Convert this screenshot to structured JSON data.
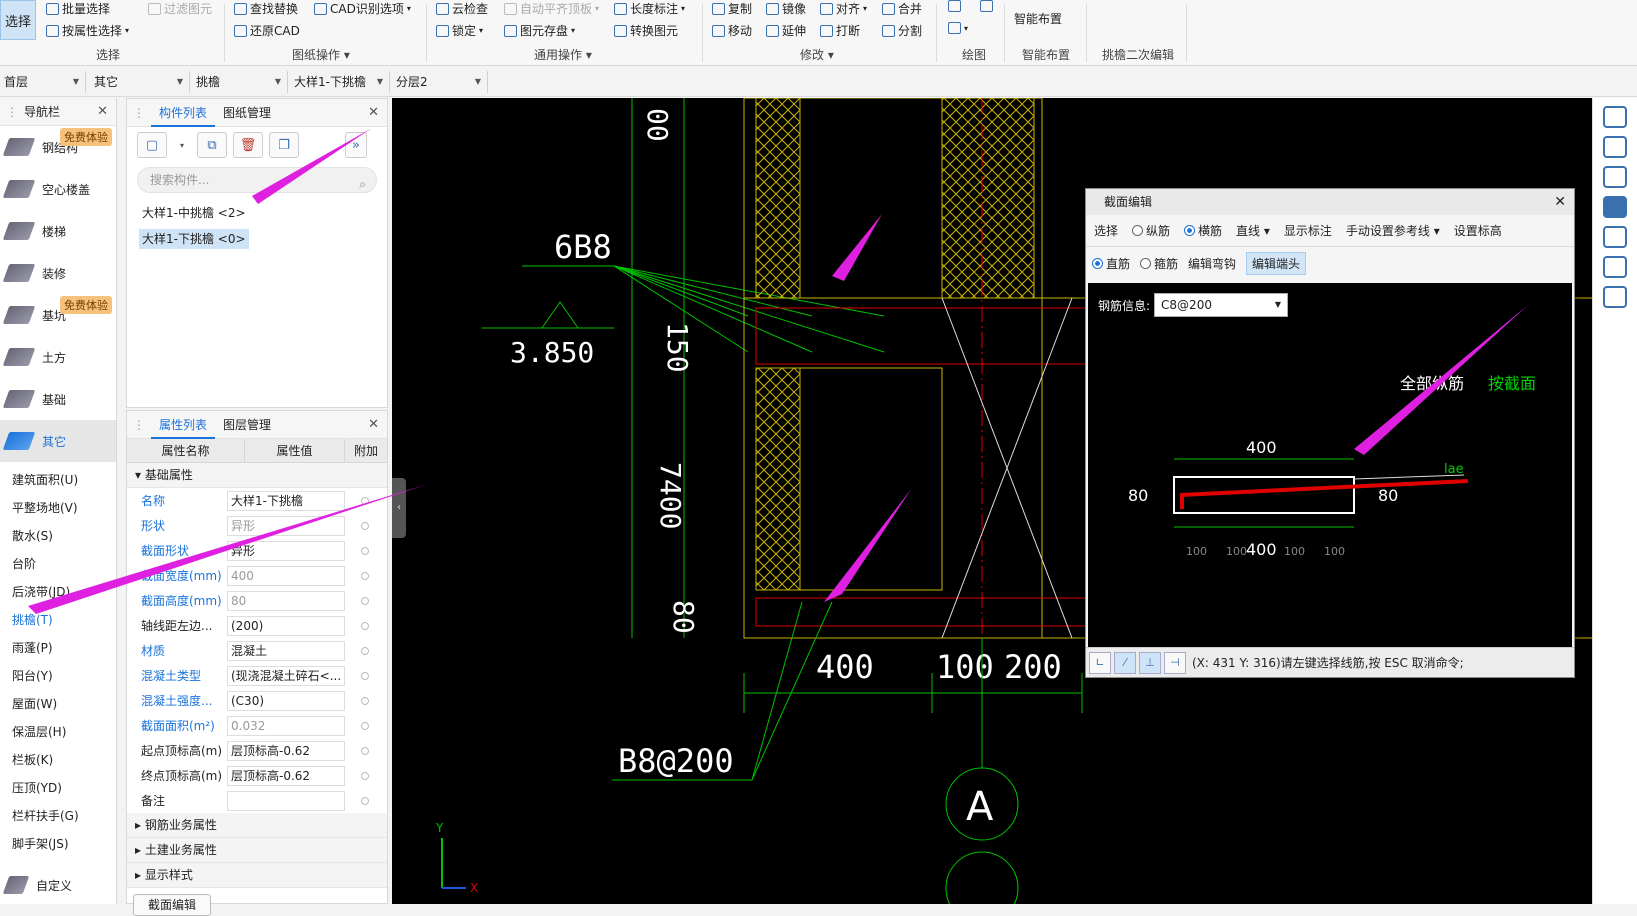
{
  "ribbon": {
    "select_label": "选择",
    "groups": {
      "select": {
        "label": "选择",
        "batch_select": "批量选择",
        "filter_graphic": "过滤图元",
        "select_by_attr": "按属性选择"
      },
      "drawing_ops": {
        "label": "图纸操作",
        "find_replace": "查找替换",
        "cad_recognize": "CAD识别选项",
        "restore_cad": "还原CAD"
      },
      "general_ops": {
        "label": "通用操作",
        "cloud_check": "云检查",
        "auto_level_slab": "自动平齐顶板",
        "lock": "锁定",
        "element_save": "图元存盘",
        "length_dim": "长度标注",
        "convert_element": "转换图元"
      },
      "modify": {
        "label": "修改",
        "copy": "复制",
        "mirror": "镜像",
        "align": "对齐",
        "merge": "合并",
        "move": "移动",
        "extend": "延伸",
        "break": "打断",
        "split": "分割"
      },
      "draw": {
        "label": "绘图"
      },
      "smart_layout": {
        "label": "智能布置",
        "button": "智能布置"
      },
      "eave_edit": {
        "label": "挑檐二次编辑"
      }
    }
  },
  "filterbar": {
    "floor": "首层",
    "category": "其它",
    "type": "挑檐",
    "component": "大样1-下挑檐",
    "layer": "分层2"
  },
  "nav": {
    "title": "导航栏",
    "items": [
      {
        "label": "钢结构",
        "badge": "免费体验"
      },
      {
        "label": "空心楼盖",
        "badge": ""
      },
      {
        "label": "楼梯",
        "badge": ""
      },
      {
        "label": "装修",
        "badge": ""
      },
      {
        "label": "基坑",
        "badge": "免费体验"
      },
      {
        "label": "土方",
        "badge": ""
      },
      {
        "label": "基础",
        "badge": ""
      },
      {
        "label": "其它",
        "badge": ""
      }
    ],
    "sub_items": [
      "建筑面积(U)",
      "平整场地(V)",
      "散水(S)",
      "台阶",
      "后浇带(JD)",
      "挑檐(T)",
      "雨蓬(P)",
      "阳台(Y)",
      "屋面(W)",
      "保温层(H)",
      "栏板(K)",
      "压顶(YD)",
      "栏杆扶手(G)",
      "脚手架(JS)"
    ],
    "custom": "自定义"
  },
  "components": {
    "tab_list": "构件列表",
    "tab_drawings": "图纸管理",
    "search_placeholder": "搜索构件...",
    "items": [
      "大样1-中挑檐 <2>",
      "大样1-下挑檐 <0>"
    ]
  },
  "properties": {
    "tab_attr": "属性列表",
    "tab_layer": "图层管理",
    "col_name": "属性名称",
    "col_value": "属性值",
    "col_extra": "附加",
    "group_basic": "基础属性",
    "rows": [
      {
        "name": "名称",
        "value": "大样1-下挑檐",
        "blue": true,
        "gray": false
      },
      {
        "name": "形状",
        "value": "异形",
        "blue": true,
        "gray": true
      },
      {
        "name": "截面形状",
        "value": "异形",
        "blue": true,
        "gray": false
      },
      {
        "name": "截面宽度(mm)",
        "value": "400",
        "blue": true,
        "gray": true
      },
      {
        "name": "截面高度(mm)",
        "value": "80",
        "blue": true,
        "gray": true
      },
      {
        "name": "轴线距左边...",
        "value": "(200)",
        "blue": false,
        "gray": false
      },
      {
        "name": "材质",
        "value": "混凝土",
        "blue": true,
        "gray": false
      },
      {
        "name": "混凝土类型",
        "value": "(现浇混凝土碎石<...",
        "blue": true,
        "gray": false
      },
      {
        "name": "混凝土强度...",
        "value": "(C30)",
        "blue": true,
        "gray": false
      },
      {
        "name": "截面面积(m²)",
        "value": "0.032",
        "blue": true,
        "gray": true
      },
      {
        "name": "起点顶标高(m)",
        "value": "层顶标高-0.62",
        "blue": false,
        "gray": false
      },
      {
        "name": "终点顶标高(m)",
        "value": "层顶标高-0.62",
        "blue": false,
        "gray": false
      },
      {
        "name": "备注",
        "value": "",
        "blue": false,
        "gray": false
      }
    ],
    "groups_collapsed": [
      "钢筋业务属性",
      "土建业务属性",
      "显示样式"
    ],
    "section_edit_btn": "截面编辑"
  },
  "cad": {
    "label_6b8": "6B8",
    "elev": "3.850",
    "dim_150": "150",
    "dim_700": "7400",
    "dim_80": "80",
    "dim_400": "400",
    "dim_100": "100",
    "dim_200": "200",
    "label_b8": "B8@200",
    "axis_a": "A"
  },
  "section_dialog": {
    "title": "截面编辑",
    "toolbar": {
      "select": "选择",
      "longitudinal": "纵筋",
      "transverse": "横筋",
      "line": "直线",
      "show_dim": "显示标注",
      "manual_ref": "手动设置参考线",
      "set_elev": "设置标高"
    },
    "toolbar2": {
      "straight": "直筋",
      "stirrup": "箍筋",
      "edit_hook": "编辑弯钩",
      "edit_end": "编辑端头"
    },
    "rebar_info_label": "钢筋信息:",
    "rebar_info_value": "C8@200",
    "canvas": {
      "all_long": "全部纵筋",
      "by_section": "按截面",
      "top_dim": "400",
      "bottom_dim": "400",
      "left_dim": "80",
      "right_dim": "80",
      "lae": "lae",
      "sub_dims": [
        "100",
        "100",
        "100",
        "100"
      ]
    },
    "status": "(X: 431 Y: 316)请左键选择线筋,按 ESC 取消命令;"
  }
}
